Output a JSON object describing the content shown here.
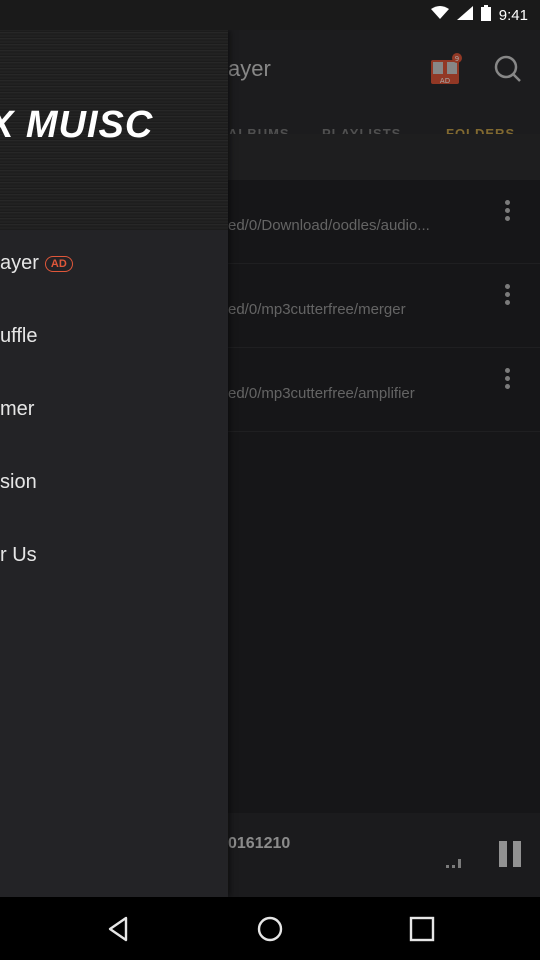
{
  "status_bar": {
    "time": "9:41",
    "icons": [
      "wifi-icon",
      "signal-icon",
      "battery-icon"
    ]
  },
  "app": {
    "title_partial": "ayer",
    "gift_badge_count": "9",
    "gift_badge_label": "AD",
    "tabs": [
      {
        "label": "ALBUMS",
        "active": false
      },
      {
        "label": "PLAYLISTS",
        "active": false
      },
      {
        "label": "FOLDERS",
        "active": true
      }
    ],
    "folders": [
      {
        "path": "ed/0/Download/oodles/audio..."
      },
      {
        "path": "ed/0/mp3cutterfree/merger"
      },
      {
        "path": "ed/0/mp3cutterfree/amplifier"
      }
    ],
    "player": {
      "track": "0161210"
    }
  },
  "drawer": {
    "brand": "X MUISC",
    "items": [
      {
        "label": "ayer",
        "badge": "AD"
      },
      {
        "label": "uffle"
      },
      {
        "label": "mer"
      },
      {
        "label": "sion"
      },
      {
        "label": "r Us"
      }
    ]
  },
  "nav": {
    "icons": [
      "back-icon",
      "home-icon",
      "recents-icon"
    ]
  },
  "colors": {
    "accent": "#c6a24a",
    "ad": "#e0573a",
    "drawer_bg": "#232326"
  }
}
